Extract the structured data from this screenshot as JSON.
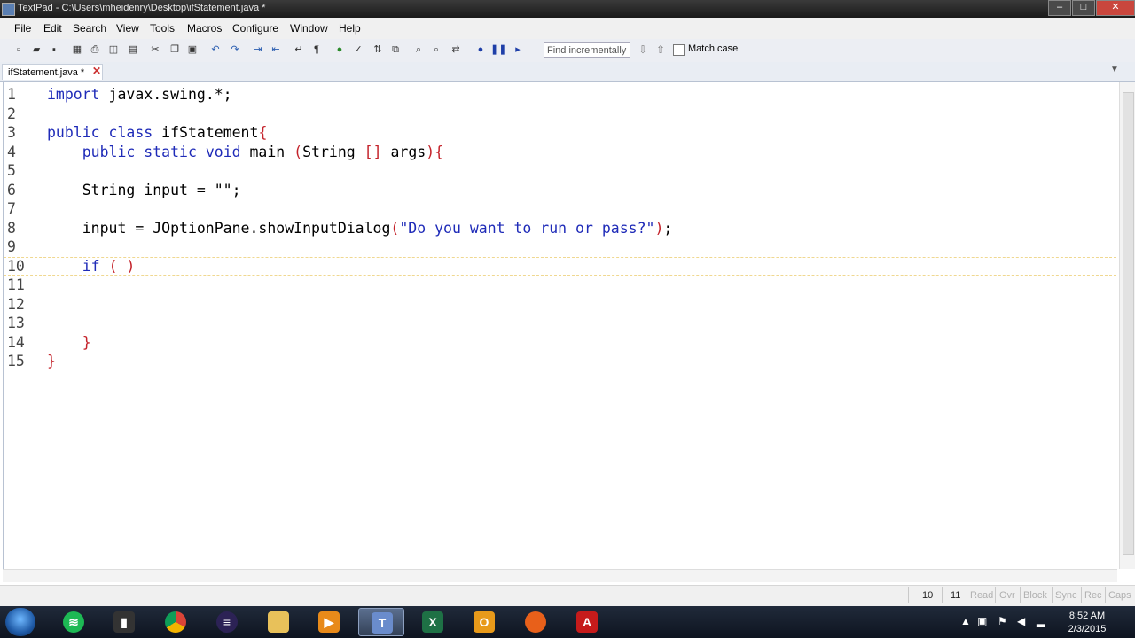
{
  "window": {
    "title": "TextPad - C:\\Users\\mheidenry\\Desktop\\ifStatement.java *",
    "minimize": "–",
    "maximize": "□",
    "close": "✕"
  },
  "menu": [
    "File",
    "Edit",
    "Search",
    "View",
    "Tools",
    "Macros",
    "Configure",
    "Window",
    "Help"
  ],
  "toolbar": {
    "find_placeholder": "Find incrementally",
    "find_down": "⇩",
    "find_up": "⇧",
    "match_case_label": "Match case",
    "icons": [
      "new-file-icon",
      "open-icon",
      "save-icon",
      "save-all-icon",
      "print-icon",
      "print-preview-icon",
      "copy-icon",
      "cut-icon",
      "copy2-icon",
      "paste-icon",
      "undo-icon",
      "redo-icon",
      "indent-icon",
      "outdent-icon",
      "word-wrap-icon",
      "pilcrow-icon",
      "web-icon",
      "spell-check-icon",
      "sort-icon",
      "compare-icon",
      "find-icon",
      "find-in-files-icon",
      "replace-icon",
      "record-macro-icon",
      "pause-icon",
      "play-icon"
    ]
  },
  "tab": {
    "label": "ifStatement.java *",
    "close": "✕"
  },
  "editor": {
    "lines": [
      {
        "n": "1",
        "html": "<span class='kw'>import</span> javax.swing.*;"
      },
      {
        "n": "2",
        "html": ""
      },
      {
        "n": "3",
        "html": "<span class='kw'>public class</span> ifStatement<span class='br'>{</span>"
      },
      {
        "n": "4",
        "html": "    <span class='kw'>public static void</span> main <span class='br'>(</span>String <span class='br'>[]</span> args<span class='br'>){</span>"
      },
      {
        "n": "5",
        "html": ""
      },
      {
        "n": "6",
        "html": "    String input = \"\";"
      },
      {
        "n": "7",
        "html": ""
      },
      {
        "n": "8",
        "html": "    input = JOptionPane.showInputDialog<span class='br'>(</span><span class='st'>\"Do you want to run or pass?\"</span><span class='br'>)</span>;"
      },
      {
        "n": "9",
        "html": ""
      },
      {
        "n": "10",
        "html": "    <span class='kw'>if</span> <span class='br'>( )</span>"
      },
      {
        "n": "11",
        "html": ""
      },
      {
        "n": "12",
        "html": ""
      },
      {
        "n": "13",
        "html": ""
      },
      {
        "n": "14",
        "html": "    <span class='br'>}</span>"
      },
      {
        "n": "15",
        "html": "<span class='br'>}</span>"
      }
    ],
    "current_line": "10"
  },
  "status": {
    "line": "10",
    "col": "11",
    "read": "Read",
    "ovr": "Ovr",
    "block": "Block",
    "sync": "Sync",
    "rec": "Rec",
    "caps": "Caps"
  },
  "taskbar": {
    "apps": [
      "spotify-icon",
      "terminal-icon",
      "chrome-icon",
      "eclipse-icon",
      "file-explorer-icon",
      "media-player-icon",
      "textpad-icon",
      "excel-icon",
      "outlook-icon",
      "firefox-icon",
      "acrobat-icon"
    ],
    "time": "8:52 AM",
    "date": "2/3/2015"
  }
}
